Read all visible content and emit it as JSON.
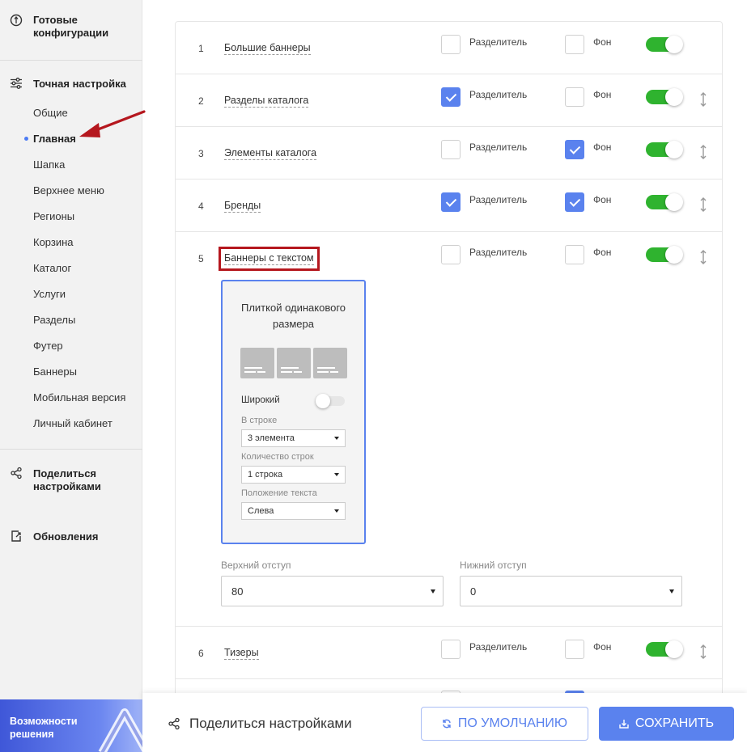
{
  "sidebar": {
    "ready_configs": "Готовые конфигурации",
    "fine_tuning": "Точная настройка",
    "items": [
      {
        "label": "Общие"
      },
      {
        "label": "Главная"
      },
      {
        "label": "Шапка"
      },
      {
        "label": "Верхнее меню"
      },
      {
        "label": "Регионы"
      },
      {
        "label": "Корзина"
      },
      {
        "label": "Каталог"
      },
      {
        "label": "Услуги"
      },
      {
        "label": "Разделы"
      },
      {
        "label": "Футер"
      },
      {
        "label": "Баннеры"
      },
      {
        "label": "Мобильная версия"
      },
      {
        "label": "Личный кабинет"
      }
    ],
    "active_item": "Главная",
    "share_settings": "Поделиться настройками",
    "updates": "Обновления",
    "promo": "Возможности решения"
  },
  "list": {
    "separator_label": "Разделитель",
    "background_label": "Фон",
    "rows": [
      {
        "num": "1",
        "name": "Большие баннеры",
        "separator": false,
        "background": false,
        "enabled": true
      },
      {
        "num": "2",
        "name": "Разделы каталога",
        "separator": true,
        "background": false,
        "enabled": true
      },
      {
        "num": "3",
        "name": "Элементы каталога",
        "separator": false,
        "background": true,
        "enabled": true
      },
      {
        "num": "4",
        "name": "Бренды",
        "separator": true,
        "background": true,
        "enabled": true
      },
      {
        "num": "5",
        "name": "Баннеры с текстом",
        "separator": false,
        "background": false,
        "enabled": true
      },
      {
        "num": "6",
        "name": "Тизеры",
        "separator": false,
        "background": false,
        "enabled": true
      }
    ]
  },
  "panel": {
    "card_title": "Плиткой одинакового размера",
    "wide_label": "Широкий",
    "wide_enabled": false,
    "per_row_label": "В строке",
    "per_row_value": "3 элемента",
    "rows_count_label": "Количество строк",
    "rows_count_value": "1 строка",
    "text_pos_label": "Положение текста",
    "text_pos_value": "Слева",
    "top_padding_label": "Верхний отступ",
    "top_padding_value": "80",
    "bottom_padding_label": "Нижний отступ",
    "bottom_padding_value": "0"
  },
  "bottombar": {
    "share_label": "Поделиться настройками",
    "default_button": "ПО УМОЛЧАНИЮ",
    "save_button": "СОХРАНИТЬ"
  },
  "colors": {
    "accent": "#5a82ee",
    "toggle_on": "#2fb32f",
    "highlight": "#b5171e",
    "sidebar_bg": "#f2f2f2"
  }
}
